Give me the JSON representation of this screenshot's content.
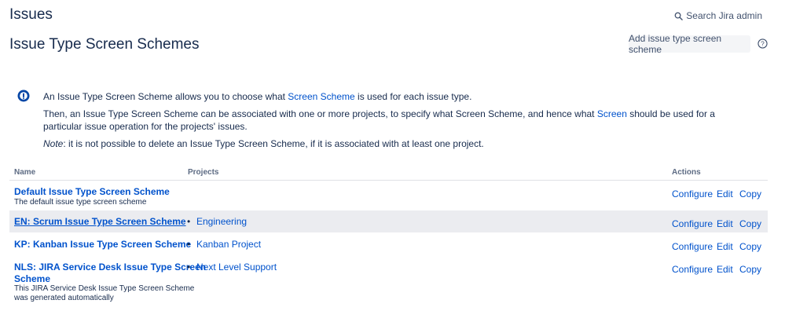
{
  "header": {
    "title": "Issues",
    "search_label": "Search Jira admin"
  },
  "page": {
    "title": "Issue Type Screen Schemes",
    "add_button": "Add issue type screen scheme"
  },
  "info": {
    "line1_a": "An Issue Type Screen Scheme allows you to choose what ",
    "line1_link": "Screen Scheme",
    "line1_b": " is used for each issue type.",
    "line2_a": "Then, an Issue Type Screen Scheme can be associated with one or more projects, to specify what Screen Scheme, and hence what ",
    "line2_link": "Screen",
    "line2_b": " should be used for a particular issue operation for the projects' issues.",
    "note_label": "Note",
    "note_text": ": it is not possible to delete an Issue Type Screen Scheme, if it is associated with at least one project."
  },
  "table": {
    "columns": {
      "name": "Name",
      "projects": "Projects",
      "actions": "Actions"
    },
    "actions": {
      "configure": "Configure",
      "edit": "Edit",
      "copy": "Copy"
    },
    "rows": [
      {
        "name": "Default Issue Type Screen Scheme",
        "description": "The default issue type screen scheme",
        "project": ""
      },
      {
        "name": "EN: Scrum Issue Type Screen Scheme",
        "description": "",
        "project": "Engineering"
      },
      {
        "name": "KP: Kanban Issue Type Screen Scheme",
        "description": "",
        "project": "Kanban Project"
      },
      {
        "name_line1": "NLS: JIRA Service Desk Issue Type Screen",
        "name_line2": "Scheme",
        "description_line1": "This JIRA Service Desk Issue Type Screen Scheme",
        "description_line2": "was generated automatically",
        "project": "Next Level Support"
      }
    ]
  },
  "colors": {
    "link": "#0052CC",
    "text": "#172B4D",
    "row_highlight": "#EBECF0"
  }
}
